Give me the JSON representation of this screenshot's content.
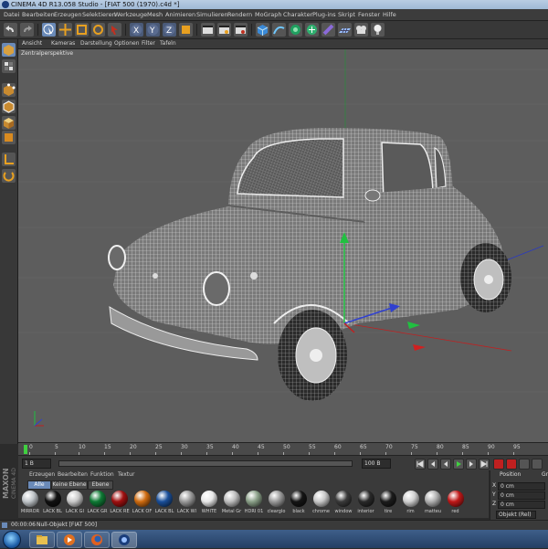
{
  "titlebar": {
    "title": "CINEMA 4D R13.058 Studio - [FIAT 500 (1970).c4d *]"
  },
  "menu": [
    "Datei",
    "Bearbeiten",
    "Erzeugen",
    "Selektieren",
    "Werkzeuge",
    "Mesh",
    "Animieren",
    "Simulieren",
    "Rendern",
    "MoGraph",
    "Charakter",
    "Plug-ins",
    "Skript",
    "Fenster",
    "Hilfe"
  ],
  "toolbar_icons": [
    "undo-icon",
    "redo-icon",
    "live-select-icon",
    "move-icon",
    "scale-icon",
    "rotate-icon",
    "x-axis-icon",
    "y-axis-icon",
    "z-axis-icon",
    "world-coord-icon",
    "render-view-icon",
    "render-picture-viewer-icon",
    "render-settings-icon",
    "cube-icon",
    "spline-pen-icon",
    "subdivision-icon",
    "array-icon",
    "deformer-icon",
    "floor-icon",
    "camera-icon",
    "light-icon"
  ],
  "viewport": {
    "menu": [
      "Ansicht",
      "Kameras",
      "Darstellung",
      "Optionen",
      "Filter",
      "Tafeln"
    ],
    "label": "Zentralperspektive"
  },
  "timeline": {
    "ticks": [
      "0",
      "5",
      "10",
      "15",
      "20",
      "25",
      "30",
      "35",
      "40",
      "45",
      "50",
      "55",
      "60",
      "65",
      "70",
      "75",
      "80",
      "85",
      "90",
      "95"
    ],
    "start_field": "1 B",
    "end_field": "100 B",
    "current_frame": "0 B"
  },
  "materials": {
    "menu": [
      "Erzeugen",
      "Bearbeiten",
      "Funktion",
      "Textur"
    ],
    "tabs": [
      "Alle",
      "Keine Ebene",
      "Ebene"
    ],
    "items": [
      {
        "name": "MIRROR",
        "color": "#bfc4c8"
      },
      {
        "name": "LACK BL",
        "color": "#111111"
      },
      {
        "name": "LACK GI",
        "color": "#c9c9c9"
      },
      {
        "name": "LACK GR",
        "color": "#0f7a35"
      },
      {
        "name": "LACK RE",
        "color": "#a01010"
      },
      {
        "name": "LACK OF",
        "color": "#d06c10"
      },
      {
        "name": "LACK BL",
        "color": "#1a4f9a"
      },
      {
        "name": "LACK WI",
        "color": "#9a9a9a"
      },
      {
        "name": "WHITE",
        "color": "#e8e8e8"
      },
      {
        "name": "Metal Gr",
        "color": "#bdbdbd"
      },
      {
        "name": "HDRI 01",
        "color": "#8aa088"
      },
      {
        "name": "clearglo",
        "color": "#9a9a9a"
      },
      {
        "name": "black",
        "color": "#151515"
      },
      {
        "name": "chrome",
        "color": "#c8c8c8"
      },
      {
        "name": "window",
        "color": "#3a3a3a"
      },
      {
        "name": "interior",
        "color": "#2a2a2a"
      },
      {
        "name": "tire",
        "color": "#1c1c1c"
      },
      {
        "name": "rim",
        "color": "#d0d0d0"
      },
      {
        "name": "matteu",
        "color": "#b0b0b0"
      },
      {
        "name": "red",
        "color": "#c01818"
      }
    ]
  },
  "coordinates": {
    "header": "Position",
    "second_header": "Gr",
    "rows": [
      {
        "axis": "X",
        "value": "0 cm"
      },
      {
        "axis": "Y",
        "value": "0 cm"
      },
      {
        "axis": "Z",
        "value": "0 cm"
      }
    ],
    "mode": "Objekt (Rel)"
  },
  "status": {
    "time": "00:00:06",
    "message": "Null-Objekt [FIAT 500]"
  },
  "colors": {
    "viewport_bg": "#5d5d5d",
    "panel": "#3a3a3a",
    "wire": "#e8e8e8",
    "x_axis": "#d02020",
    "y_axis": "#20c040",
    "z_axis": "#3040d0"
  }
}
